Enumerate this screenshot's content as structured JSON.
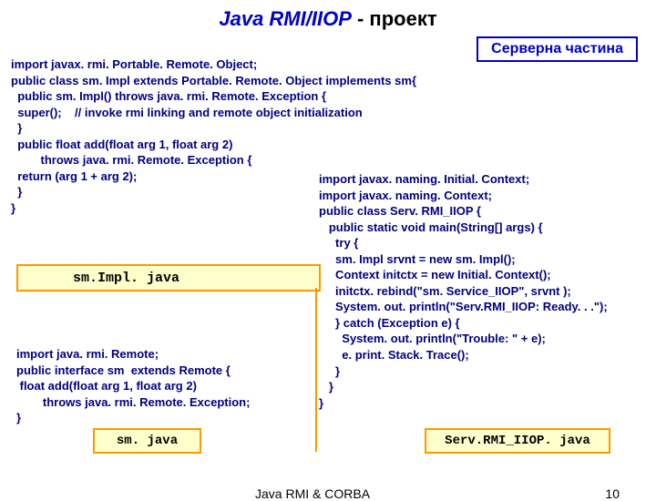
{
  "title": {
    "emph": "Java RMI/IIOP",
    "rest": " - проект"
  },
  "server_label": "Серверна частина",
  "code_top": "import javax. rmi. Portable. Remote. Object;\npublic class sm. Impl extends Portable. Remote. Object implements sm{\n  public sm. Impl() throws java. rmi. Remote. Exception {\n  super();    // invoke rmi linking and remote object initialization\n  }\n  public float add(float arg 1, float arg 2)\n         throws java. rmi. Remote. Exception {\n  return (arg 1 + arg 2);\n  }\n}",
  "code_right": "import javax. naming. Initial. Context;\nimport javax. naming. Context;\npublic class Serv. RMI_IIOP {\n   public static void main(String[] args) {\n     try {\n     sm. Impl srvnt = new sm. Impl();\n     Context initctx = new Initial. Context();\n     initctx. rebind(\"sm. Service_IIOP\", srvnt );\n     System. out. println(\"Serv.RMI_IIOP: Ready. . .\");\n     } catch (Exception e) {\n       System. out. println(\"Trouble: \" + e);\n       e. print. Stack. Trace();\n     }\n   }\n}",
  "code_left2": "import java. rmi. Remote;\npublic interface sm  extends Remote {\n float add(float arg 1, float arg 2)\n        throws java. rmi. Remote. Exception;\n}",
  "labels": {
    "smimpl": "sm.Impl. java",
    "sm": "sm. java",
    "serv": "Serv.RMI_IIOP. java"
  },
  "footer": {
    "text": "Java RMI & CORBA",
    "page": "10"
  }
}
